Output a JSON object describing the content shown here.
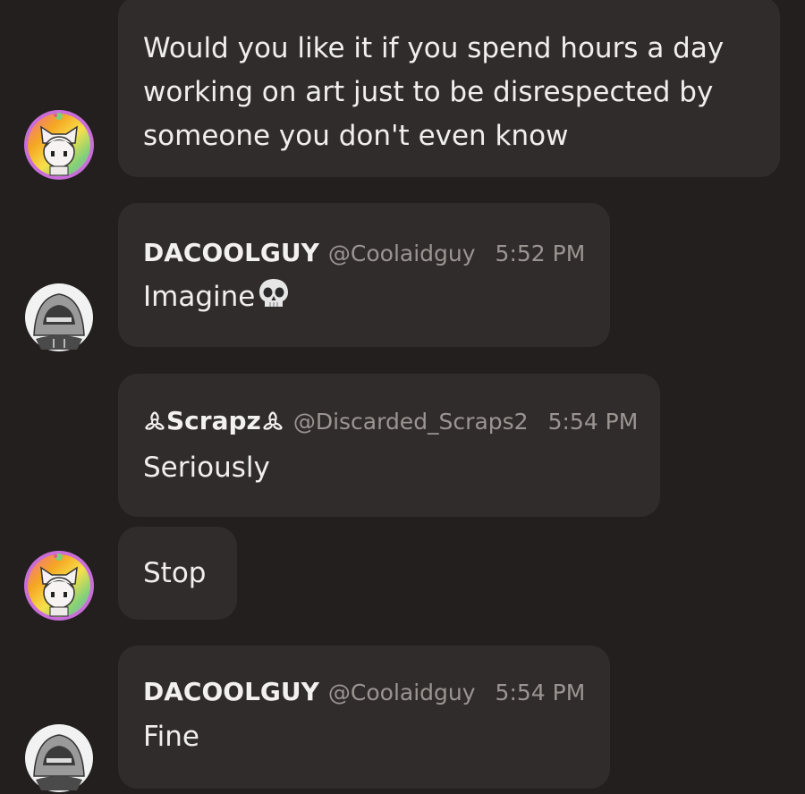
{
  "messages": [
    {
      "avatar_icon": "cat-girl-avatar-icon",
      "text": "Would you like it if you spend hours a day working on art just to be disrespected by someone you don't even know"
    },
    {
      "avatar_icon": "hooded-figure-avatar-icon",
      "name": "DACOOLGUY",
      "handle": "@Coolaidguy",
      "time": "5:52 PM",
      "text": "Imagine",
      "emoji": "skull-emoji"
    },
    {
      "name_prefix_icon": "biohazard-icon",
      "name": "Scrapz",
      "name_suffix_icon": "biohazard-icon",
      "handle": "@Discarded_Scraps2",
      "time": "5:54 PM",
      "text": "Seriously"
    },
    {
      "avatar_icon": "cat-girl-avatar-icon",
      "text": "Stop"
    },
    {
      "avatar_icon": "hooded-figure-avatar-icon",
      "name": "DACOOLGUY",
      "handle": "@Coolaidguy",
      "time": "5:54 PM",
      "text": "Fine"
    }
  ],
  "colors": {
    "background": "#221f1e",
    "bubble": "#302c2b",
    "text": "#f1efee",
    "muted": "#9a9592"
  }
}
